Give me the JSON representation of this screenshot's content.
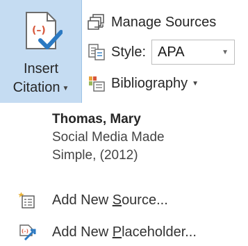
{
  "ribbon": {
    "insert_citation": {
      "label_line1": "Insert",
      "label_line2": "Citation",
      "icon": "insert-citation-icon"
    },
    "manage_sources": {
      "label": "Manage Sources",
      "icon": "manage-sources-icon"
    },
    "style": {
      "label": "Style:",
      "value": "APA",
      "icon": "style-icon"
    },
    "bibliography": {
      "label": "Bibliography",
      "icon": "bibliography-icon"
    }
  },
  "menu": {
    "citation": {
      "author": "Thomas, Mary",
      "title_line1": "Social Media Made",
      "title_line2": "Simple, (2012)"
    },
    "add_source": {
      "label_pre": "Add New ",
      "mnemonic": "S",
      "label_post": "ource...",
      "icon": "add-source-icon"
    },
    "add_placeholder": {
      "label_pre": "Add New ",
      "mnemonic": "P",
      "label_post": "laceholder...",
      "icon": "add-placeholder-icon"
    }
  },
  "colors": {
    "selected_bg": "#c5dcf2",
    "citation_red": "#d7563a",
    "check_blue": "#2b79c2"
  }
}
